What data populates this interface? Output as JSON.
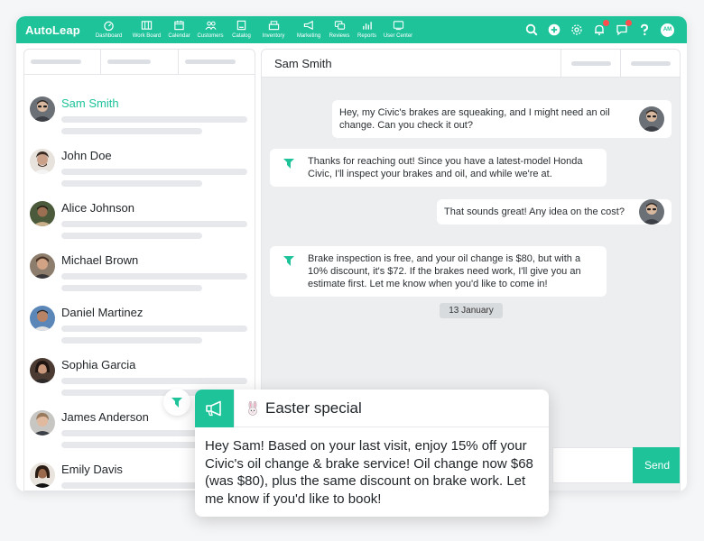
{
  "app": {
    "logo": "AutoLeap",
    "brand_color": "#1ec39a"
  },
  "nav": {
    "items": [
      {
        "label": "Dashboard",
        "icon": "dashboard-icon"
      },
      {
        "label": "Work Board",
        "icon": "work-board-icon"
      },
      {
        "label": "Calendar",
        "icon": "calendar-icon"
      },
      {
        "label": "Customers",
        "icon": "customers-icon"
      },
      {
        "label": "Catalog",
        "icon": "catalog-icon"
      },
      {
        "label": "Inventory",
        "icon": "inventory-icon"
      },
      {
        "label": "Marketing",
        "icon": "megaphone-icon"
      },
      {
        "label": "Reviews",
        "icon": "reviews-icon"
      },
      {
        "label": "Reports",
        "icon": "reports-icon"
      },
      {
        "label": "User Center",
        "icon": "user-center-icon"
      }
    ],
    "user_initials": "AM"
  },
  "contacts": [
    {
      "name": "Sam Smith",
      "active": true
    },
    {
      "name": "John Doe"
    },
    {
      "name": "Alice Johnson"
    },
    {
      "name": "Michael Brown"
    },
    {
      "name": "Daniel Martinez"
    },
    {
      "name": "Sophia Garcia"
    },
    {
      "name": "James Anderson"
    },
    {
      "name": "Emily Davis"
    }
  ],
  "chat": {
    "title": "Sam Smith",
    "messages": [
      {
        "dir": "out",
        "text": "Hey, my Civic's brakes are squeaking, and I might need an oil change. Can you check it out?"
      },
      {
        "dir": "in",
        "text": "Thanks for reaching out! Since you have a latest-model Honda Civic, I'll inspect your brakes and oil, and while we're at."
      },
      {
        "dir": "out",
        "text": "That sounds great! Any idea on the cost?"
      },
      {
        "dir": "in",
        "text": "Brake inspection is free, and your oil change is $80, but with a 10% discount, it's $72. If the brakes need work, I'll give you an estimate first. Let me know when you'd like to come in!"
      }
    ],
    "date_chip": "13 January",
    "send_label": "Send"
  },
  "popup": {
    "title": "Easter special",
    "body": "Hey Sam! Based on your last visit, enjoy 15% off your Civic's oil change & brake service! Oil change now $68 (was $80), plus the same discount on brake work. Let me know if you'd like to book!"
  }
}
